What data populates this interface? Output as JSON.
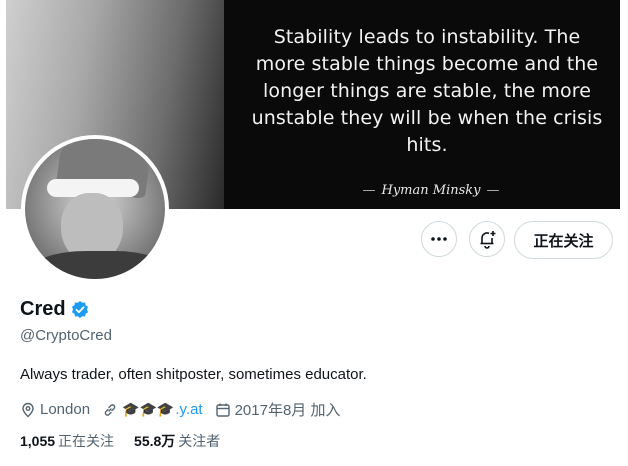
{
  "banner": {
    "quote_lines": [
      "Stability leads to instability. The",
      "more stable things become and the",
      "longer things are stable, the more",
      "unstable they will be when the crisis",
      "hits."
    ],
    "attribution": "Hyman Minsky"
  },
  "actions": {
    "more_icon": "more-horizontal-icon",
    "notify_icon": "bell-plus-icon",
    "follow_label": "正在关注"
  },
  "profile": {
    "display_name": "Cred",
    "verified": true,
    "handle": "@CryptoCred",
    "bio": "Always trader, often shitposter, sometimes educator."
  },
  "meta": {
    "location": "London",
    "link_text": ".y.at",
    "link_emoji": "🎓🎓🎓",
    "joined": "2017年8月 加入"
  },
  "stats": {
    "following_count": "1,055",
    "following_label": "正在关注",
    "followers_count": "55.8万",
    "followers_label": "关注者"
  },
  "colors": {
    "accent": "#1d9bf0",
    "muted": "#536471",
    "text": "#0f1419"
  }
}
